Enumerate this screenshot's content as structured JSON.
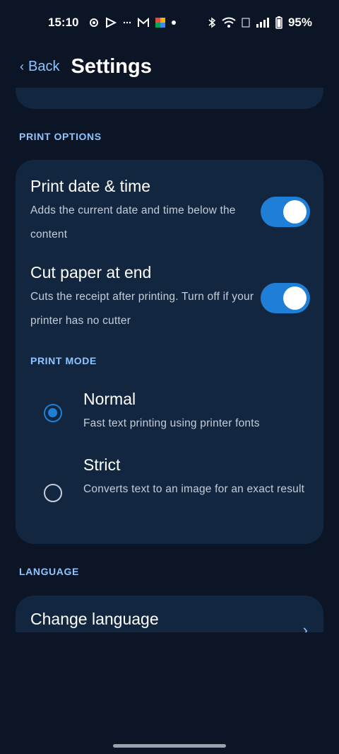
{
  "status_bar": {
    "time": "15:10",
    "battery": "95%",
    "left_icons": [
      "gear-icon",
      "play-icon",
      "dots-icon",
      "gmail-icon",
      "app-icon",
      "dot-icon"
    ],
    "right_icons": [
      "bluetooth-icon",
      "wifi-icon",
      "volte-icon",
      "signal-icon",
      "battery-icon"
    ]
  },
  "header": {
    "back_label": "Back",
    "title": "Settings"
  },
  "sections": {
    "print_options": {
      "label": "PRINT OPTIONS",
      "rows": [
        {
          "title": "Print date & time",
          "description": "Adds the current date and time below the content",
          "enabled": true
        },
        {
          "title": "Cut paper at end",
          "description": "Cuts the receipt after printing. Turn off if your printer has no cutter",
          "enabled": true
        }
      ],
      "print_mode": {
        "label": "PRINT MODE",
        "options": [
          {
            "title": "Normal",
            "description": "Fast text printing using printer fonts",
            "selected": true
          },
          {
            "title": "Strict",
            "description": "Converts text to an image for an exact result",
            "selected": false
          }
        ]
      }
    },
    "language": {
      "label": "LANGUAGE",
      "item_title": "Change language"
    }
  },
  "colors": {
    "background": "#0b1525",
    "card": "#132640",
    "accent": "#1f7fd6",
    "section_label": "#8ec4ff"
  }
}
